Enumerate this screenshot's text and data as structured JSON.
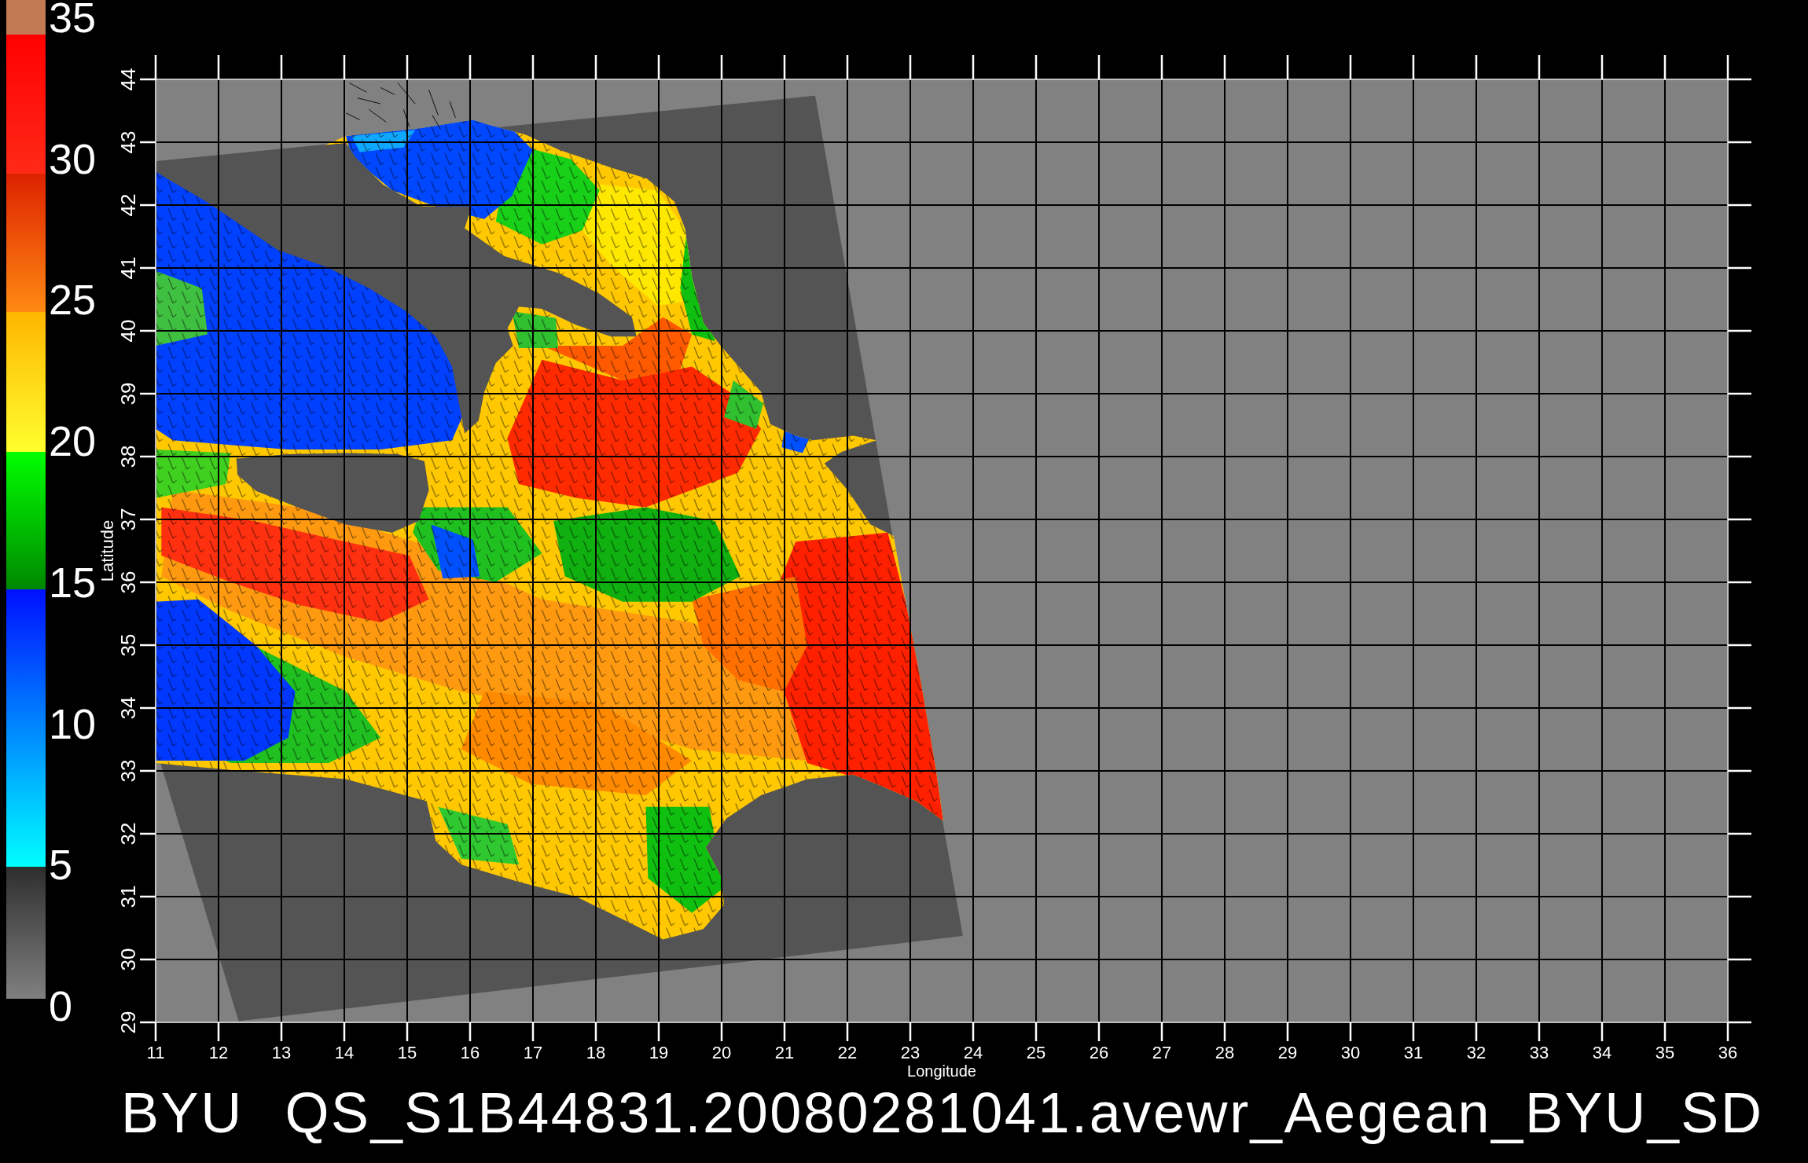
{
  "color_scale": {
    "labels": [
      "35",
      "30",
      "25",
      "20",
      "15",
      "10",
      "5",
      "0"
    ]
  },
  "map": {
    "y_axis": {
      "title": "Latitude",
      "ticks": [
        "44",
        "43",
        "42",
        "41",
        "40",
        "39",
        "38",
        "37",
        "36",
        "35",
        "34",
        "33",
        "32",
        "31",
        "30",
        "29"
      ]
    },
    "x_axis": {
      "title": "Longitude",
      "ticks": [
        "11",
        "12",
        "13",
        "14",
        "15",
        "16",
        "17",
        "18",
        "19",
        "20",
        "21",
        "22",
        "23",
        "24",
        "25",
        "26",
        "27",
        "28",
        "29",
        "30",
        "31",
        "32",
        "33",
        "34",
        "35",
        "36"
      ]
    }
  },
  "caption": "BYU QS_S1B44831.20080281041.avewr_Aegean_BYU_SD"
}
